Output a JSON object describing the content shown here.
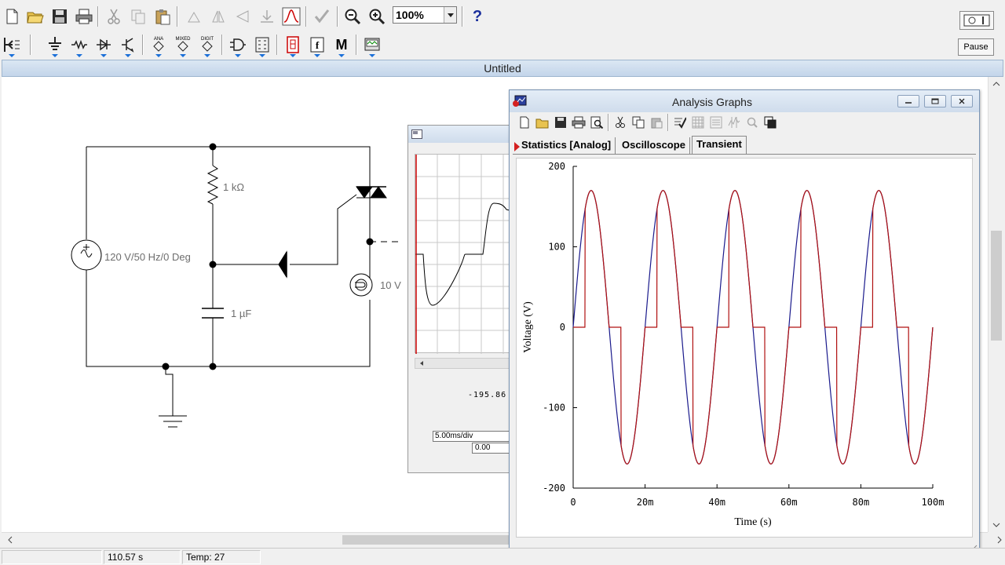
{
  "toolbar": {
    "zoom": {
      "value": "100%"
    },
    "help_label": "?",
    "pause_label": "Pause",
    "ana_label": "ANA",
    "mixed_label": "MIXED",
    "digit_label": "DIGIT",
    "f_label": "f",
    "m_label": "M"
  },
  "main_window": {
    "title": "Untitled"
  },
  "schematic": {
    "resistor_label": "1 kΩ",
    "source_label": "120 V/50 Hz/0 Deg",
    "capacitor_label": "1 µF",
    "lamp_label": "10   V"
  },
  "scope_window": {
    "readout": "-195.86",
    "timebase": "5.00ms/div",
    "position": "0.00"
  },
  "graphs_window": {
    "title": "Analysis Graphs",
    "tabs": [
      {
        "label": "Statistics [Analog]"
      },
      {
        "label": "Oscilloscope"
      },
      {
        "label": "Transient"
      }
    ],
    "active_tab": "Transient"
  },
  "status": {
    "time": "110.57 s",
    "temp": "Temp:  27"
  },
  "colors": {
    "source_trace": "#1a1a8c",
    "output_trace": "#b01010",
    "wire": "#000000",
    "component_label": "#6e6e6e"
  },
  "chart_data": {
    "type": "line",
    "xlabel": "Time (s)",
    "ylabel": "Voltage (V)",
    "xlim": [
      0,
      0.1
    ],
    "ylim": [
      -200,
      200
    ],
    "x_ticks": [
      {
        "value": 0,
        "label": "0"
      },
      {
        "value": 0.02,
        "label": "20m"
      },
      {
        "value": 0.04,
        "label": "40m"
      },
      {
        "value": 0.06,
        "label": "60m"
      },
      {
        "value": 0.08,
        "label": "80m"
      },
      {
        "value": 0.1,
        "label": "100m"
      }
    ],
    "y_ticks": [
      {
        "value": 200,
        "label": "200"
      },
      {
        "value": 100,
        "label": "100"
      },
      {
        "value": 0,
        "label": "0"
      },
      {
        "value": -100,
        "label": "-100"
      },
      {
        "value": -200,
        "label": "-200"
      }
    ],
    "series": [
      {
        "kind": "sine",
        "amplitude": 170,
        "frequency_hz": 50,
        "color": "#1a1a8c"
      },
      {
        "kind": "phase-controlled",
        "amplitude": 170,
        "frequency_hz": 50,
        "conduction_start_deg": 60,
        "color": "#b01010"
      }
    ],
    "grid": false
  }
}
